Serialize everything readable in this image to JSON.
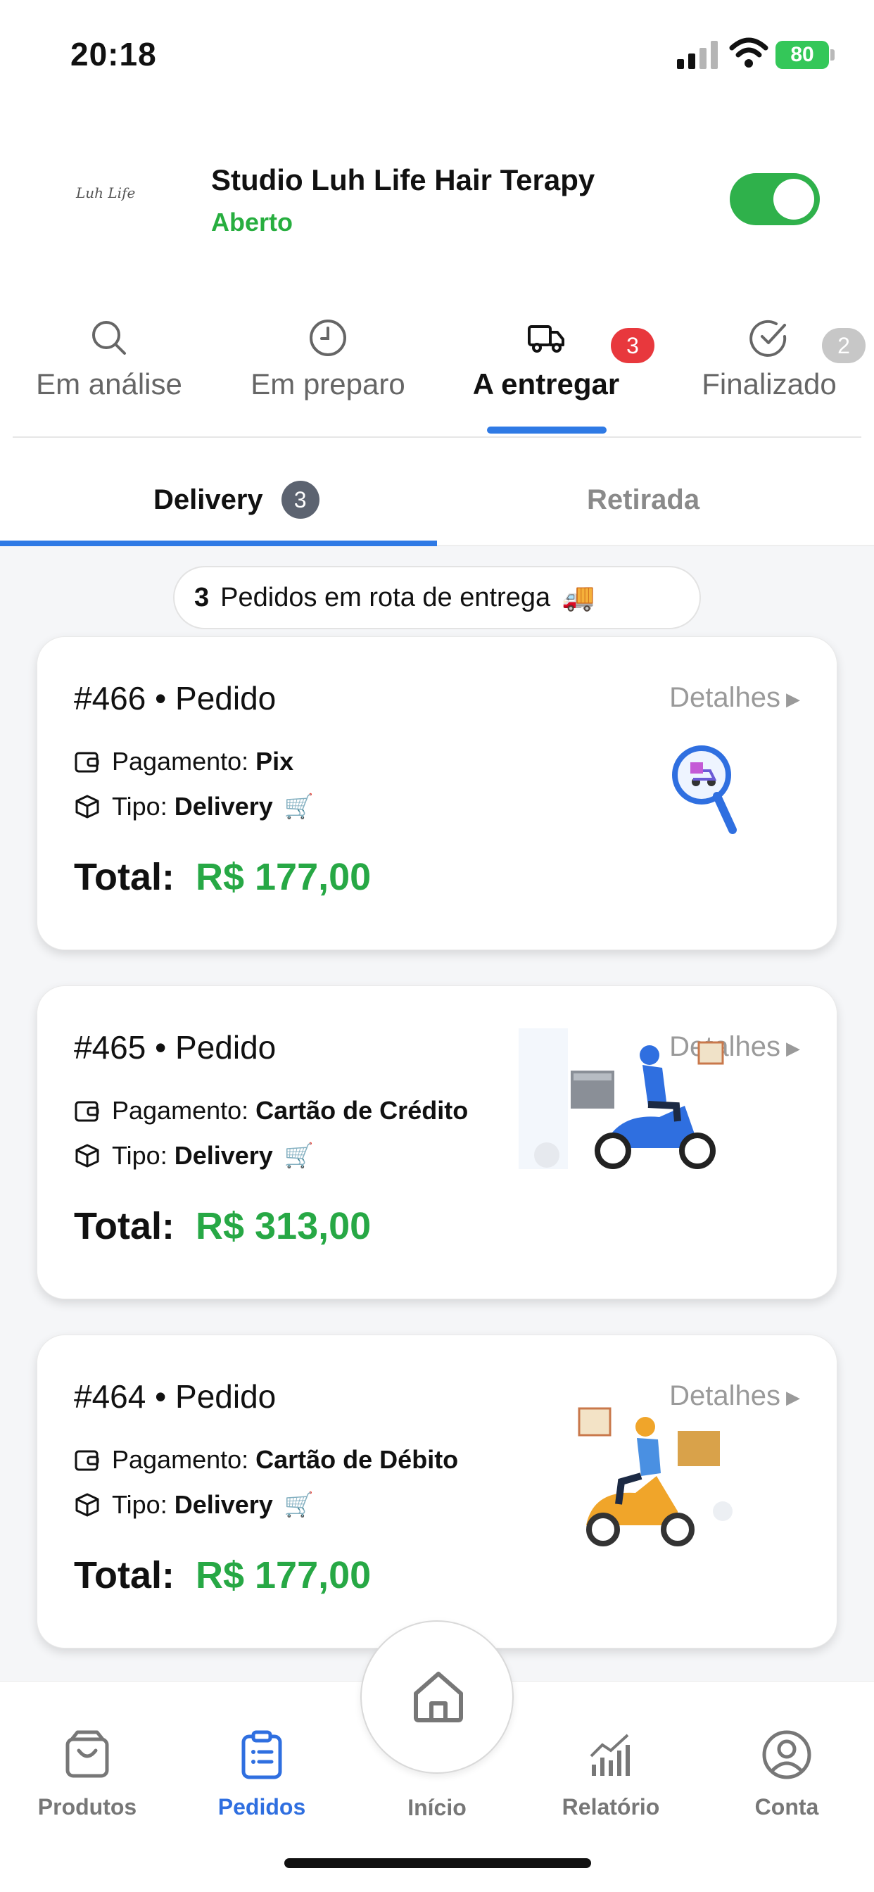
{
  "status_bar": {
    "time": "20:18",
    "battery": "80"
  },
  "store": {
    "logo_text": "Luh Life",
    "name": "Studio Luh Life Hair Terapy",
    "status": "Aberto",
    "open": true
  },
  "status_tabs": [
    {
      "label": "Em análise",
      "icon": "search-icon"
    },
    {
      "label": "Em preparo",
      "icon": "clock-icon"
    },
    {
      "label": "A entregar",
      "icon": "truck-icon",
      "badge": "3",
      "active": true
    },
    {
      "label": "Finalizado",
      "icon": "check-circle-icon",
      "badge": "2"
    }
  ],
  "sub_tabs": {
    "delivery": "Delivery",
    "delivery_count": "3",
    "pickup": "Retirada"
  },
  "route_banner": {
    "count": "3",
    "text": "Pedidos em rota de entrega",
    "emoji": "🚚"
  },
  "orders": [
    {
      "number": "#466",
      "label": "Pedido",
      "details": "Detalhes",
      "payment_label": "Pagamento:",
      "payment": "Pix",
      "type_label": "Tipo:",
      "type": "Delivery",
      "total_label": "Total:",
      "total": "R$ 177,00"
    },
    {
      "number": "#465",
      "label": "Pedido",
      "details": "Detalhes",
      "payment_label": "Pagamento:",
      "payment": "Cartão de Crédito",
      "type_label": "Tipo:",
      "type": "Delivery",
      "total_label": "Total:",
      "total": "R$ 313,00"
    },
    {
      "number": "#464",
      "label": "Pedido",
      "details": "Detalhes",
      "payment_label": "Pagamento:",
      "payment": "Cartão de Débito",
      "type_label": "Tipo:",
      "type": "Delivery",
      "total_label": "Total:",
      "total": "R$ 177,00"
    }
  ],
  "bottom_nav": {
    "products": "Produtos",
    "orders": "Pedidos",
    "home": "Início",
    "report": "Relatório",
    "account": "Conta"
  },
  "colors": {
    "accent_blue": "#2f7ae5",
    "open_green": "#27ae3f",
    "total_green": "#27a845",
    "badge_red": "#e8383d",
    "badge_gray": "#c7c7c7"
  }
}
